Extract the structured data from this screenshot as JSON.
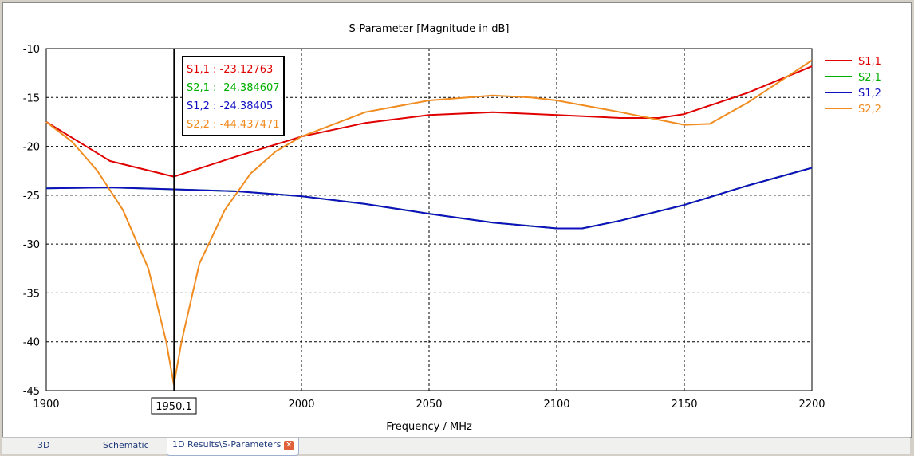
{
  "chart_data": {
    "type": "line",
    "title": "S-Parameter [Magnitude in dB]",
    "xlabel": "Frequency / MHz",
    "ylabel": "",
    "xlim": [
      1900,
      2200
    ],
    "ylim": [
      -45,
      -10
    ],
    "xticks": [
      "1900",
      "1950",
      "2000",
      "2050",
      "2100",
      "2150",
      "2200"
    ],
    "yticks": [
      "-10",
      "-15",
      "-20",
      "-25",
      "-30",
      "-35",
      "-40",
      "-45"
    ],
    "grid": true,
    "legend_position": "right",
    "series": [
      {
        "name": "S1,1",
        "color": "#e00000",
        "x": [
          1900,
          1925,
          1950,
          1975,
          2000,
          2025,
          2050,
          2075,
          2100,
          2125,
          2140,
          2150,
          2175,
          2200
        ],
        "y": [
          -17.5,
          -21.5,
          -23.1,
          -21,
          -19,
          -17.6,
          -16.8,
          -16.5,
          -16.8,
          -17.1,
          -17.1,
          -16.7,
          -14.5,
          -11.8
        ]
      },
      {
        "name": "S2,1",
        "color": "#00b000",
        "x": [
          1900,
          1925,
          1950,
          1975,
          2000,
          2025,
          2050,
          2075,
          2100,
          2110,
          2125,
          2150,
          2175,
          2200
        ],
        "y": [
          -24.3,
          -24.2,
          -24.4,
          -24.6,
          -25.1,
          -25.9,
          -26.9,
          -27.8,
          -28.4,
          -28.4,
          -27.6,
          -26.0,
          -24,
          -22.2
        ]
      },
      {
        "name": "S1,2",
        "color": "#1010c0",
        "x": [
          1900,
          1925,
          1950,
          1975,
          2000,
          2025,
          2050,
          2075,
          2100,
          2110,
          2125,
          2150,
          2175,
          2200
        ],
        "y": [
          -24.3,
          -24.2,
          -24.4,
          -24.6,
          -25.1,
          -25.9,
          -26.9,
          -27.8,
          -28.4,
          -28.4,
          -27.6,
          -26.0,
          -24,
          -22.2
        ]
      },
      {
        "name": "S2,2",
        "color": "#f08c20",
        "x": [
          1900,
          1910,
          1920,
          1930,
          1940,
          1947,
          1950,
          1953,
          1960,
          1970,
          1980,
          1990,
          2000,
          2025,
          2050,
          2075,
          2090,
          2100,
          2125,
          2150,
          2160,
          2175,
          2200
        ],
        "y": [
          -17.5,
          -19.5,
          -22.5,
          -26.5,
          -32.5,
          -40,
          -44.4,
          -40,
          -32,
          -26.5,
          -22.8,
          -20.5,
          -19,
          -16.5,
          -15.3,
          -14.8,
          -15,
          -15.3,
          -16.5,
          -17.8,
          -17.7,
          -15.5,
          -11.2
        ]
      }
    ],
    "marker": {
      "x": 1950.1,
      "label": "1950.1",
      "readouts": [
        "S1,1 : -23.12763",
        "S2,1 : -24.384607",
        "S1,2 : -24.38405",
        "S2,2 : -44.437471"
      ]
    }
  },
  "tabs": [
    {
      "label": "3D"
    },
    {
      "label": "Schematic"
    },
    {
      "label": "1D Results\\S-Parameters"
    }
  ]
}
